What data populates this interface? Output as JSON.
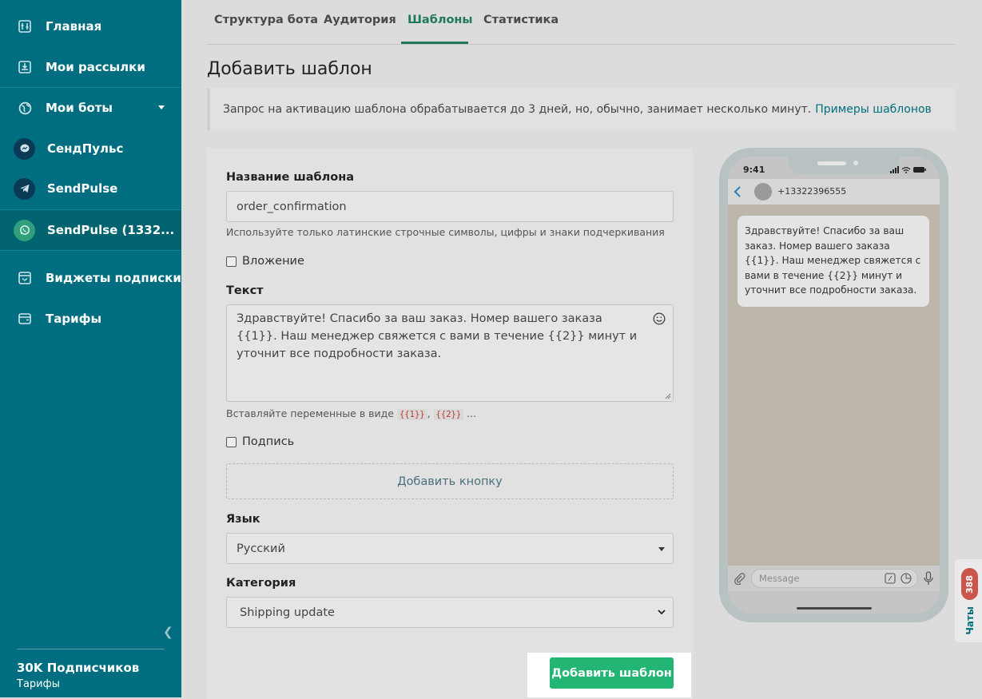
{
  "sidebar": {
    "items": [
      {
        "label": "Главная",
        "icon": "home-icon"
      },
      {
        "label": "Мои рассылки",
        "icon": "mailings-icon"
      },
      {
        "label": "Мои боты",
        "icon": "globe-icon"
      },
      {
        "label": "СендПульс",
        "icon": "messenger-icon"
      },
      {
        "label": "SendPulse",
        "icon": "telegram-icon"
      },
      {
        "label": "SendPulse (1332...",
        "icon": "whatsapp-icon"
      },
      {
        "label": "Виджеты подписки",
        "icon": "widget-icon"
      },
      {
        "label": "Тарифы",
        "icon": "wallet-icon"
      }
    ],
    "subscribers": "30K Подписчиков",
    "plans_link": "Тарифы"
  },
  "tabs": [
    "Структура бота",
    "Аудитория",
    "Шаблоны",
    "Статистика"
  ],
  "active_tab": "Шаблоны",
  "page_title": "Добавить шаблон",
  "notice": {
    "text": "Запрос на активацию шаблона обрабатывается до 3 дней, но, обычно, занимает несколько минут.",
    "link": "Примеры шаблонов"
  },
  "form": {
    "name_label": "Название шаблона",
    "name_value": "order_confirmation",
    "name_hint": "Используйте только латинские строчные символы, цифры и знаки подчеркивания",
    "attachment_label": "Вложение",
    "attachment_checked": false,
    "text_label": "Текст",
    "text_value": "Здравствуйте! Спасибо за ваш заказ. Номер вашего заказа {{1}}. Наш менеджер свяжется с вами в течение {{2}} минут и уточнит все подробности заказа.",
    "vars_hint_prefix": "Вставляйте переменные в виде",
    "var1": "{{1}}",
    "var2": "{{2}}",
    "vars_hint_suffix": "...",
    "signature_label": "Подпись",
    "signature_checked": false,
    "add_button_label": "Добавить кнопку",
    "language_label": "Язык",
    "language_value": "Русский",
    "category_label": "Категория",
    "category_value": "Shipping update"
  },
  "submit_label": "Добавить шаблон",
  "preview": {
    "time": "9:41",
    "phone_number": "+13322396555",
    "message": "Здравствуйте! Спасибо за ваш заказ. Номер вашего заказа {{1}}. Наш менеджер свяжется с вами в течение {{2}} минут и уточнит все подробности заказа.",
    "input_placeholder": "Message"
  },
  "chats": {
    "label": "Чаты",
    "count": "388"
  },
  "colors": {
    "sidebar": "#006e80",
    "accent_green": "#22b573",
    "tab_active": "#1f7a58",
    "link": "#006f7e",
    "badge": "#c9564a"
  }
}
